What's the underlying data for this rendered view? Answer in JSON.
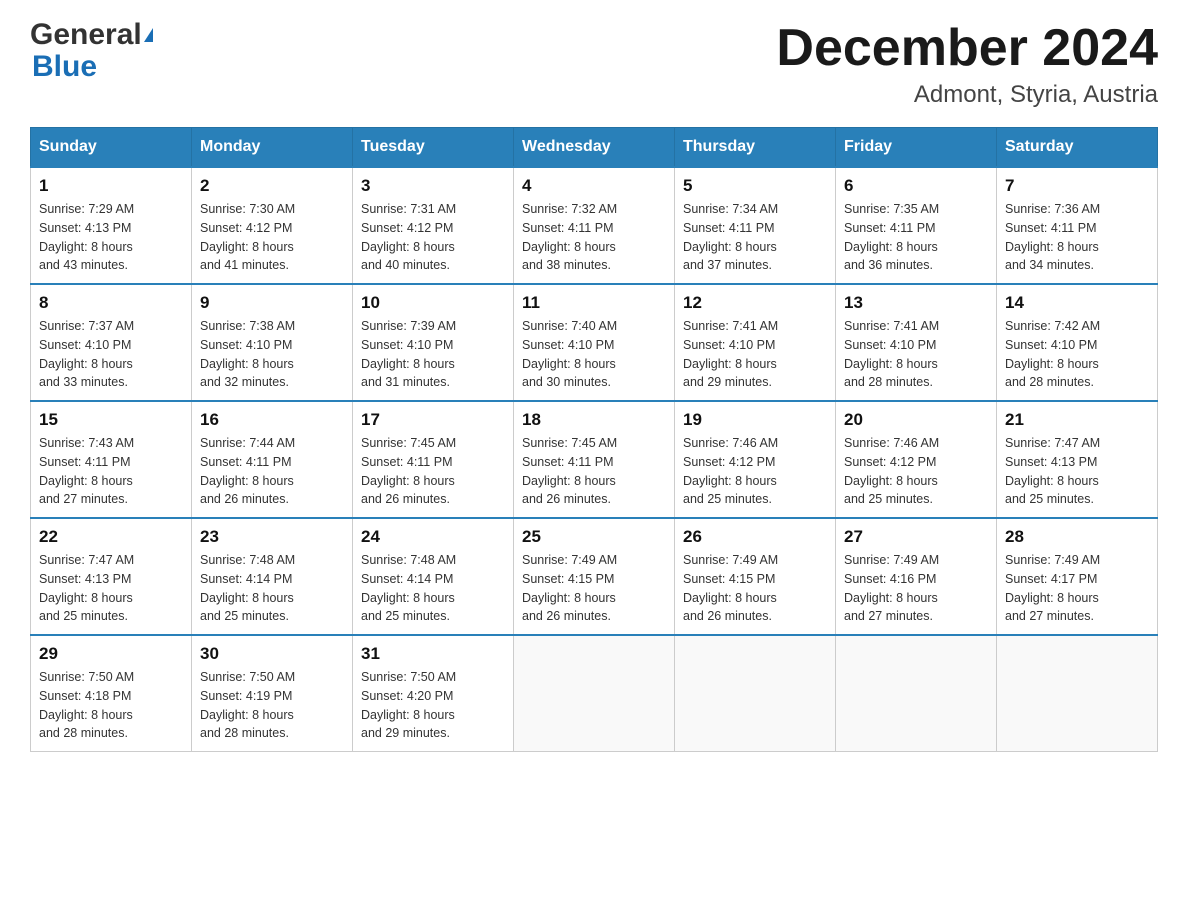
{
  "header": {
    "logo_general": "General",
    "logo_blue": "Blue",
    "month_title": "December 2024",
    "location": "Admont, Styria, Austria"
  },
  "weekdays": [
    "Sunday",
    "Monday",
    "Tuesday",
    "Wednesday",
    "Thursday",
    "Friday",
    "Saturday"
  ],
  "weeks": [
    [
      {
        "day": "1",
        "sunrise": "7:29 AM",
        "sunset": "4:13 PM",
        "daylight": "8 hours and 43 minutes."
      },
      {
        "day": "2",
        "sunrise": "7:30 AM",
        "sunset": "4:12 PM",
        "daylight": "8 hours and 41 minutes."
      },
      {
        "day": "3",
        "sunrise": "7:31 AM",
        "sunset": "4:12 PM",
        "daylight": "8 hours and 40 minutes."
      },
      {
        "day": "4",
        "sunrise": "7:32 AM",
        "sunset": "4:11 PM",
        "daylight": "8 hours and 38 minutes."
      },
      {
        "day": "5",
        "sunrise": "7:34 AM",
        "sunset": "4:11 PM",
        "daylight": "8 hours and 37 minutes."
      },
      {
        "day": "6",
        "sunrise": "7:35 AM",
        "sunset": "4:11 PM",
        "daylight": "8 hours and 36 minutes."
      },
      {
        "day": "7",
        "sunrise": "7:36 AM",
        "sunset": "4:11 PM",
        "daylight": "8 hours and 34 minutes."
      }
    ],
    [
      {
        "day": "8",
        "sunrise": "7:37 AM",
        "sunset": "4:10 PM",
        "daylight": "8 hours and 33 minutes."
      },
      {
        "day": "9",
        "sunrise": "7:38 AM",
        "sunset": "4:10 PM",
        "daylight": "8 hours and 32 minutes."
      },
      {
        "day": "10",
        "sunrise": "7:39 AM",
        "sunset": "4:10 PM",
        "daylight": "8 hours and 31 minutes."
      },
      {
        "day": "11",
        "sunrise": "7:40 AM",
        "sunset": "4:10 PM",
        "daylight": "8 hours and 30 minutes."
      },
      {
        "day": "12",
        "sunrise": "7:41 AM",
        "sunset": "4:10 PM",
        "daylight": "8 hours and 29 minutes."
      },
      {
        "day": "13",
        "sunrise": "7:41 AM",
        "sunset": "4:10 PM",
        "daylight": "8 hours and 28 minutes."
      },
      {
        "day": "14",
        "sunrise": "7:42 AM",
        "sunset": "4:10 PM",
        "daylight": "8 hours and 28 minutes."
      }
    ],
    [
      {
        "day": "15",
        "sunrise": "7:43 AM",
        "sunset": "4:11 PM",
        "daylight": "8 hours and 27 minutes."
      },
      {
        "day": "16",
        "sunrise": "7:44 AM",
        "sunset": "4:11 PM",
        "daylight": "8 hours and 26 minutes."
      },
      {
        "day": "17",
        "sunrise": "7:45 AM",
        "sunset": "4:11 PM",
        "daylight": "8 hours and 26 minutes."
      },
      {
        "day": "18",
        "sunrise": "7:45 AM",
        "sunset": "4:11 PM",
        "daylight": "8 hours and 26 minutes."
      },
      {
        "day": "19",
        "sunrise": "7:46 AM",
        "sunset": "4:12 PM",
        "daylight": "8 hours and 25 minutes."
      },
      {
        "day": "20",
        "sunrise": "7:46 AM",
        "sunset": "4:12 PM",
        "daylight": "8 hours and 25 minutes."
      },
      {
        "day": "21",
        "sunrise": "7:47 AM",
        "sunset": "4:13 PM",
        "daylight": "8 hours and 25 minutes."
      }
    ],
    [
      {
        "day": "22",
        "sunrise": "7:47 AM",
        "sunset": "4:13 PM",
        "daylight": "8 hours and 25 minutes."
      },
      {
        "day": "23",
        "sunrise": "7:48 AM",
        "sunset": "4:14 PM",
        "daylight": "8 hours and 25 minutes."
      },
      {
        "day": "24",
        "sunrise": "7:48 AM",
        "sunset": "4:14 PM",
        "daylight": "8 hours and 25 minutes."
      },
      {
        "day": "25",
        "sunrise": "7:49 AM",
        "sunset": "4:15 PM",
        "daylight": "8 hours and 26 minutes."
      },
      {
        "day": "26",
        "sunrise": "7:49 AM",
        "sunset": "4:15 PM",
        "daylight": "8 hours and 26 minutes."
      },
      {
        "day": "27",
        "sunrise": "7:49 AM",
        "sunset": "4:16 PM",
        "daylight": "8 hours and 27 minutes."
      },
      {
        "day": "28",
        "sunrise": "7:49 AM",
        "sunset": "4:17 PM",
        "daylight": "8 hours and 27 minutes."
      }
    ],
    [
      {
        "day": "29",
        "sunrise": "7:50 AM",
        "sunset": "4:18 PM",
        "daylight": "8 hours and 28 minutes."
      },
      {
        "day": "30",
        "sunrise": "7:50 AM",
        "sunset": "4:19 PM",
        "daylight": "8 hours and 28 minutes."
      },
      {
        "day": "31",
        "sunrise": "7:50 AM",
        "sunset": "4:20 PM",
        "daylight": "8 hours and 29 minutes."
      },
      null,
      null,
      null,
      null
    ]
  ],
  "labels": {
    "sunrise": "Sunrise:",
    "sunset": "Sunset:",
    "daylight": "Daylight:"
  }
}
